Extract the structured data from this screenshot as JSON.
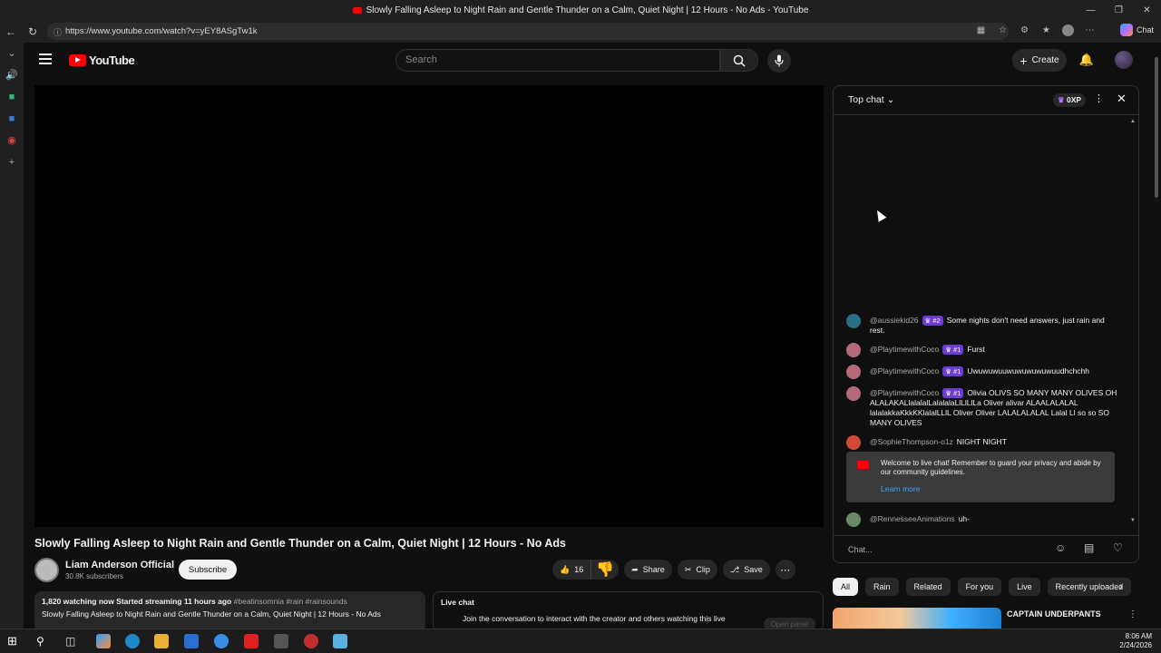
{
  "window": {
    "title": "Slowly Falling Asleep to Night Rain and Gentle Thunder on a Calm, Quiet Night | 12 Hours - No Ads - YouTube"
  },
  "browser": {
    "url": "https://www.youtube.com/watch?v=yEY8ASgTw1k",
    "copilot_label": "Chat"
  },
  "masthead": {
    "logo_text": "YouTube",
    "search_placeholder": "Search",
    "create_label": "Create"
  },
  "video": {
    "title": "Slowly Falling Asleep to Night Rain and Gentle Thunder on a Calm, Quiet Night | 12 Hours - No Ads",
    "channel_name": "Liam Anderson Official",
    "subscribers": "30.8K subscribers",
    "subscribe_label": "Subscribe",
    "like_count": "16",
    "share_label": "Share",
    "clip_label": "Clip",
    "save_label": "Save"
  },
  "description": {
    "watching": "1,820 watching now  Started streaming 11 hours ago",
    "tags": "#beatinsomnia #rain #rainsounds",
    "line2": "Slowly Falling Asleep to Night Rain and Gentle Thunder on a Calm, Quiet Night | 12 Hours - No Ads"
  },
  "livechat_preview": {
    "heading": "Live chat",
    "text": "Join the conversation to interact with the creator and others watching this live",
    "open_label": "Open panel"
  },
  "chat": {
    "header": "Top chat",
    "xp": "0XP",
    "messages": [
      {
        "author": "@aussiekid26",
        "badge": "♛ #2",
        "text": "Some nights don't need answers, just rain and rest.",
        "color": "#2b6f86"
      },
      {
        "author": "@PlaytimewithCoco",
        "badge": "♛ #1",
        "text": "Furst",
        "color": "#b56a7a"
      },
      {
        "author": "@PlaytimewithCoco",
        "badge": "♛ #1",
        "text": "Uwuwuwuuwuwuwuwuwuudhchchh",
        "color": "#b56a7a"
      },
      {
        "author": "@PlaytimewithCoco",
        "badge": "♛ #1",
        "text": "Olivia OLIVS SO MANY MANY OLIVES OH ALALAKALlalalalLalalalaLlLlLlLa Oliver alivar ALAALALALAL lalalakkaKkkKKlalalLLlL Oliver Oliver LALALALALAL Lalal Ll so so SO MANY OLIVES",
        "color": "#b56a7a"
      },
      {
        "author": "@SophieThompson-o1z",
        "badge": "",
        "text": "NIGHT NIGHT",
        "color": "#d04a3a"
      }
    ],
    "welcome_text": "Welcome to live chat! Remember to guard your privacy and abide by our community guidelines.",
    "learn_more": "Learn more",
    "last_author": "@RennesseeAnimations",
    "last_text": "uh-",
    "input_placeholder": "Chat..."
  },
  "chips": [
    "All",
    "Rain",
    "Related",
    "For you",
    "Live",
    "Recently uploaded"
  ],
  "recommended": {
    "title": "CAPTAIN UNDERPANTS"
  },
  "clock": {
    "time": "8:06 AM",
    "date": "2/24/2026"
  }
}
